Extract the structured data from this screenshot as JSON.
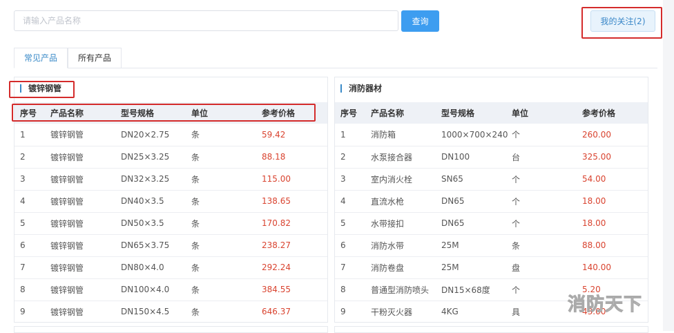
{
  "search": {
    "placeholder": "请输入产品名称",
    "button": "查询"
  },
  "follow_button": "我的关注(2)",
  "tabs": [
    {
      "label": "常见产品",
      "active": true
    },
    {
      "label": "所有产品",
      "active": false
    }
  ],
  "columns": [
    "序号",
    "产品名称",
    "型号规格",
    "单位",
    "参考价格"
  ],
  "panels": [
    {
      "title": "镀锌钢管",
      "rows": [
        [
          "1",
          "镀锌钢管",
          "DN20×2.75",
          "条",
          "59.42"
        ],
        [
          "2",
          "镀锌钢管",
          "DN25×3.25",
          "条",
          "88.18"
        ],
        [
          "3",
          "镀锌钢管",
          "DN32×3.25",
          "条",
          "115.00"
        ],
        [
          "4",
          "镀锌钢管",
          "DN40×3.5",
          "条",
          "138.65"
        ],
        [
          "5",
          "镀锌钢管",
          "DN50×3.5",
          "条",
          "170.82"
        ],
        [
          "6",
          "镀锌钢管",
          "DN65×3.75",
          "条",
          "238.27"
        ],
        [
          "7",
          "镀锌钢管",
          "DN80×4.0",
          "条",
          "292.24"
        ],
        [
          "8",
          "镀锌钢管",
          "DN100×4.0",
          "条",
          "384.55"
        ],
        [
          "9",
          "镀锌钢管",
          "DN150×4.5",
          "条",
          "646.37"
        ]
      ]
    },
    {
      "title": "消防器材",
      "rows": [
        [
          "1",
          "消防箱",
          "1000×700×240",
          "个",
          "260.00"
        ],
        [
          "2",
          "水泵接合器",
          "DN100",
          "台",
          "325.00"
        ],
        [
          "3",
          "室内消火栓",
          "SN65",
          "个",
          "54.00"
        ],
        [
          "4",
          "直流水枪",
          "DN65",
          "个",
          "18.00"
        ],
        [
          "5",
          "水带接扣",
          "DN65",
          "个",
          "18.00"
        ],
        [
          "6",
          "消防水带",
          "25M",
          "条",
          "88.00"
        ],
        [
          "7",
          "消防卷盘",
          "25M",
          "盘",
          "140.00"
        ],
        [
          "8",
          "普通型消防喷头",
          "DN15×68度",
          "个",
          "5.20"
        ],
        [
          "9",
          "干粉灭火器",
          "4KG",
          "具",
          "43.00"
        ]
      ]
    }
  ],
  "watermark": "消防天下",
  "colors": {
    "accent": "#3d9df0",
    "price": "#d9432f",
    "highlight": "#d42b2b"
  }
}
